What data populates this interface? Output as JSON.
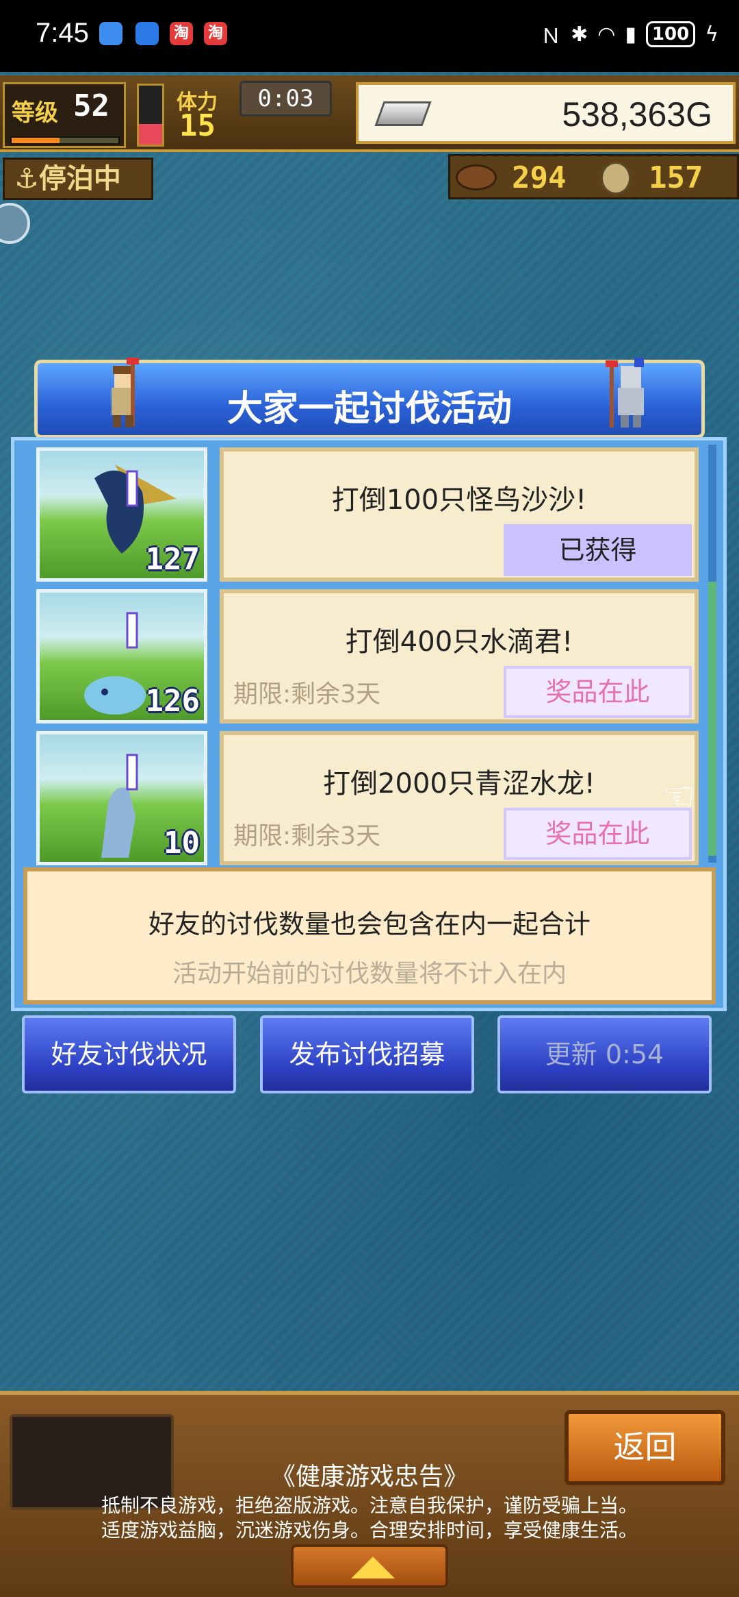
{
  "status_bar": {
    "time": "7:45",
    "apps": [
      "淘",
      "淘"
    ],
    "battery": "100"
  },
  "hud": {
    "level_label": "等级",
    "level": "52",
    "level_progress": 0.45,
    "stamina_label": "体力",
    "stamina": "15",
    "stamina_level": 0.35,
    "timer": "0:03",
    "gold": "538,363G",
    "dock_status": "停泊中",
    "wood": "294",
    "coins": "157"
  },
  "event": {
    "title": "大家一起讨伐活动",
    "quests": [
      {
        "name": "打倒100只怪鸟沙沙!",
        "count": "127",
        "deadline": "",
        "status": "已获得",
        "done": true
      },
      {
        "name": "打倒400只水滴君!",
        "count": "126",
        "deadline": "期限:剩余3天",
        "status": "奖品在此",
        "done": false
      },
      {
        "name": "打倒2000只青涩水龙!",
        "count": "10",
        "deadline": "期限:剩余3天",
        "status": "奖品在此",
        "done": false
      }
    ],
    "info_main": "好友的讨伐数量也会包含在内一起合计",
    "info_sub": "活动开始前的讨伐数量将不计入在内",
    "buttons": {
      "friends": "好友讨伐状况",
      "recruit": "发布讨伐招募",
      "refresh": "更新 0:54"
    }
  },
  "bottom": {
    "back": "返回",
    "notice_title": "《健康游戏忠告》",
    "notice_line1": "抵制不良游戏，拒绝盗版游戏。注意自我保护，谨防受骗上当。",
    "notice_line2": "适度游戏益脑，沉迷游戏伤身。合理安排时间，享受健康生活。"
  },
  "colors": {
    "panel_blue": "#5aa5e8",
    "card_cream": "#f8ecce",
    "status_pink": "#e56fb0",
    "done_purple": "#cac1ff"
  }
}
